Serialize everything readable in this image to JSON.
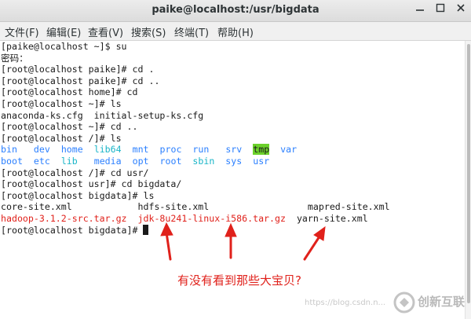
{
  "window": {
    "title": "paike@localhost:/usr/bigdata"
  },
  "menu": [
    "文件(F)",
    "编辑(E)",
    "查看(V)",
    "搜索(S)",
    "终端(T)",
    "帮助(H)"
  ],
  "terminal": {
    "lines": [
      "[paike@localhost ~]$ su",
      "密码：",
      "[root@localhost paike]# cd .",
      "[root@localhost paike]# cd ..",
      "[root@localhost home]# cd",
      "[root@localhost ~]# ls",
      "anaconda-ks.cfg  initial-setup-ks.cfg",
      "[root@localhost ~]# cd ..",
      "[root@localhost /]# ls",
      null,
      null,
      "[root@localhost /]# cd usr/",
      "[root@localhost usr]# cd bigdata/",
      "[root@localhost bigdata]# ls",
      null,
      null,
      "[root@localhost bigdata]# "
    ],
    "root_ls": {
      "row1": [
        "bin",
        "dev",
        "home",
        "lib64",
        "mnt",
        "proc",
        "run",
        "srv",
        "tmp",
        "var"
      ],
      "row2": [
        "boot",
        "etc",
        "lib",
        "media",
        "opt",
        "root",
        "sbin",
        "sys",
        "usr"
      ]
    },
    "bigdata_ls": {
      "row1": [
        "core-site.xml",
        "hdfs-site.xml",
        "mapred-site.xml"
      ],
      "row2": [
        "hadoop-3.1.2-src.tar.gz",
        "jdk-8u241-linux-i586.tar.gz",
        "yarn-site.xml"
      ]
    }
  },
  "annotation": {
    "caption": "有没有看到那些大宝贝?"
  },
  "watermark": {
    "url": "https://blog.csdn.n...",
    "brand": "创新互联"
  },
  "colors": {
    "directory": "#2a7fff",
    "symlink": "#19b5c8",
    "archive": "#e0211b",
    "highlight_bg": "#6bd12a",
    "arrow": "#e0211b"
  }
}
